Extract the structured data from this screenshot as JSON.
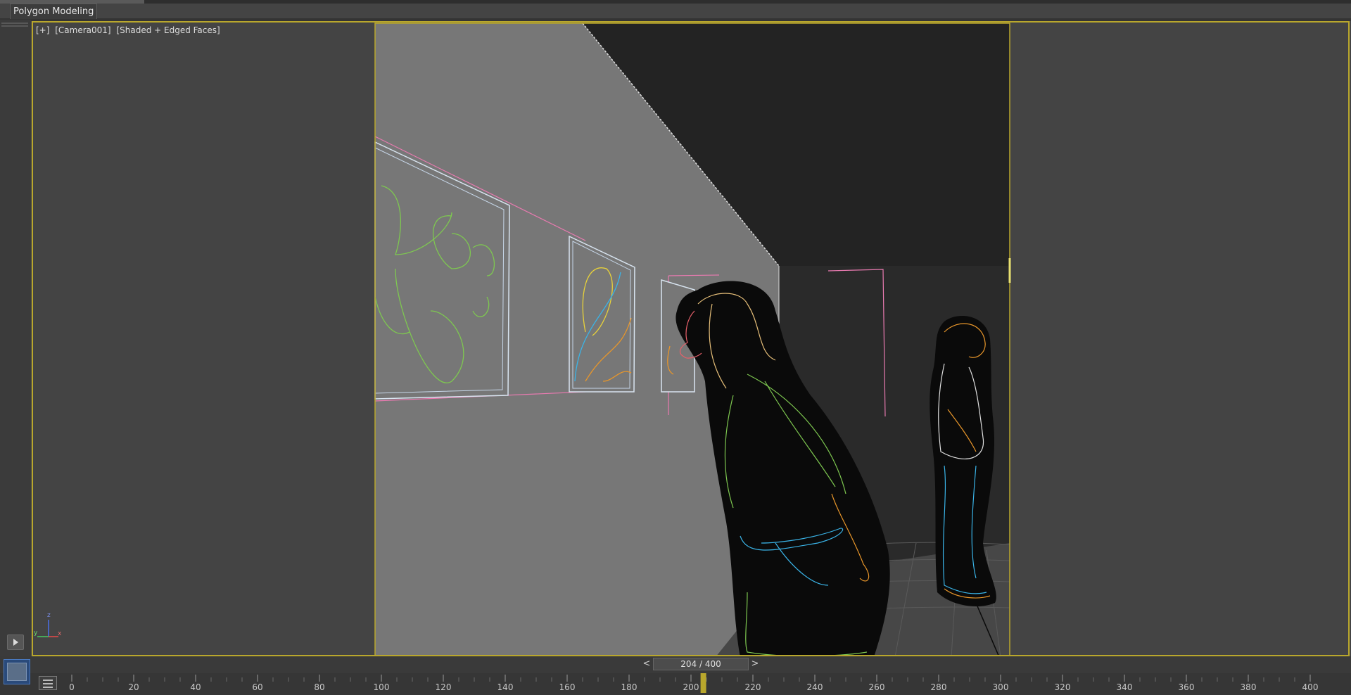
{
  "ribbon": {
    "active_tab": "Polygon Modeling"
  },
  "viewport": {
    "label_plus": "[+]",
    "label_camera": "[Camera001]",
    "label_shading": "[Shaded + Edged Faces]",
    "frame_color": "#b9a72c",
    "axes": {
      "z": "z",
      "y": "y",
      "x": "x"
    }
  },
  "timeline": {
    "prev_label": "<",
    "next_label": ">",
    "frame_readout": "204 / 400",
    "current_frame": 204,
    "total_frames": 400,
    "tick_labels": [
      "0",
      "20",
      "40",
      "60",
      "80",
      "100",
      "120",
      "140",
      "160",
      "180",
      "200",
      "220",
      "240",
      "260",
      "280",
      "300",
      "320",
      "340",
      "360",
      "380",
      "400"
    ]
  },
  "colors": {
    "background": "#444444",
    "accent": "#b9a72c",
    "slider_marker": "#b9a72c"
  }
}
